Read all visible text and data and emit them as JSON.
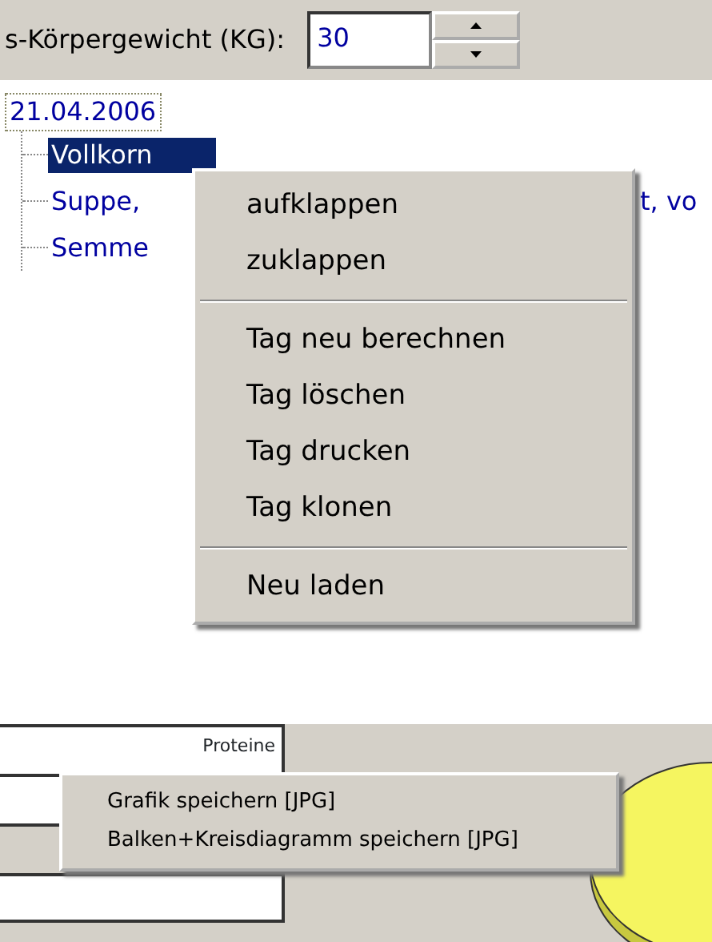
{
  "toolbar": {
    "label": "s-Körpergewicht (KG):",
    "value": "30"
  },
  "tree": {
    "label": "21.04.2006",
    "focused": true,
    "children": [
      {
        "label": "Vollkorn",
        "selected": true
      },
      {
        "label": "Suppe,",
        "label_tail": "t, vo",
        "selected": false
      },
      {
        "label": "Semme",
        "selected": false
      }
    ]
  },
  "context_menu": {
    "items": [
      {
        "kind": "item",
        "label": "aufklappen"
      },
      {
        "kind": "item",
        "label": "zuklappen"
      },
      {
        "kind": "separator"
      },
      {
        "kind": "item",
        "label": "Tag neu berechnen"
      },
      {
        "kind": "item",
        "label": "Tag löschen"
      },
      {
        "kind": "item",
        "label": "Tag drucken"
      },
      {
        "kind": "item",
        "label": "Tag klonen"
      },
      {
        "kind": "separator"
      },
      {
        "kind": "item",
        "label": "Neu laden"
      }
    ]
  },
  "nutrient_table": {
    "rows": [
      {
        "cell": "Proteine",
        "shaded": false
      },
      {
        "shaded": false
      },
      {
        "shaded": true
      },
      {
        "shaded": false
      }
    ]
  },
  "chart_menu": {
    "items": [
      "Grafik speichern [JPG]",
      "Balken+Kreisdiagramm speichern [JPG]"
    ]
  }
}
